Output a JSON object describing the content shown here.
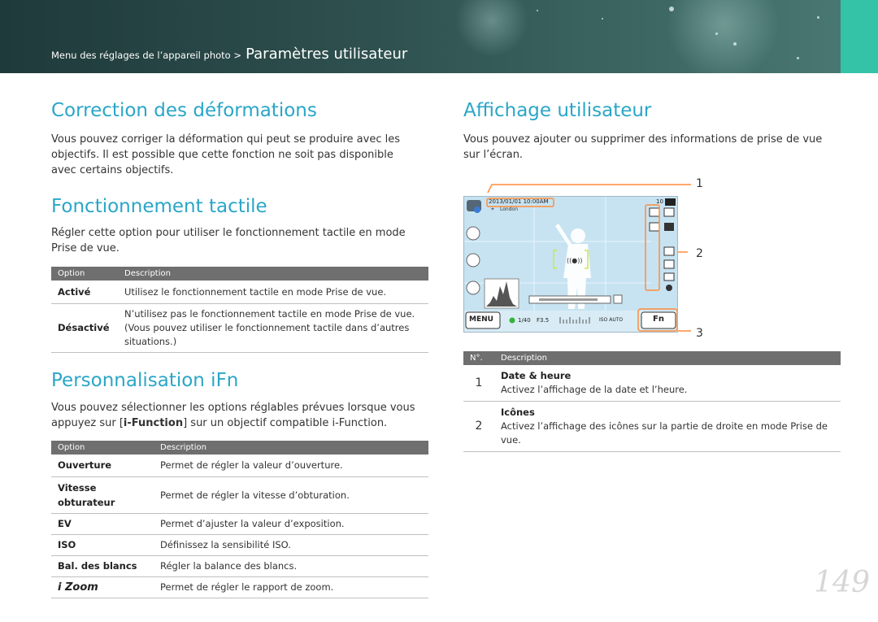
{
  "header": {
    "breadcrumb_small": "Menu des réglages de l’appareil photo >",
    "breadcrumb_big": "Paramètres utilisateur",
    "colors": {
      "accent": "#2aa6c7",
      "teal": "#35c3a8"
    }
  },
  "left": {
    "s1": {
      "title": "Correction des déformations",
      "body": "Vous pouvez corriger la déformation qui peut se produire avec les objectifs. Il est possible que cette fonction ne soit pas disponible avec certains objectifs."
    },
    "s2": {
      "title": "Fonctionnement tactile",
      "body": "Régler cette option pour utiliser le fonctionnement tactile en mode Prise de vue.",
      "head_option": "Option",
      "head_desc": "Description",
      "rows": [
        {
          "k": "Activé",
          "v": "Utilisez le fonctionnement tactile en mode Prise de vue."
        },
        {
          "k": "Désactivé",
          "v": "N’utilisez pas le fonctionnement tactile en mode Prise de vue. (Vous pouvez utiliser le fonctionnement tactile dans d’autres situations.)"
        }
      ]
    },
    "s3": {
      "title": "Personnalisation iFn",
      "body_pre": "Vous pouvez sélectionner les options réglables prévues lorsque vous appuyez sur [",
      "body_bold": "i-Function",
      "body_post": "] sur un objectif compatible i-Function.",
      "head_option": "Option",
      "head_desc": "Description",
      "rows": [
        {
          "k": "Ouverture",
          "v": "Permet de régler la valeur d’ouverture."
        },
        {
          "k": "Vitesse obturateur",
          "v": "Permet de régler la vitesse d’obturation."
        },
        {
          "k": "EV",
          "v": "Permet d’ajuster la valeur d’exposition."
        },
        {
          "k": "ISO",
          "v": "Définissez la sensibilité ISO."
        },
        {
          "k": "Bal. des blancs",
          "v": "Régler la balance des blancs."
        },
        {
          "k": "i Zoom",
          "v": "Permet de régler le rapport de zoom."
        }
      ]
    }
  },
  "right": {
    "title": "Affichage utilisateur",
    "body": "Vous pouvez ajouter ou supprimer des informations de prise de vue sur l’écran.",
    "callouts": [
      "1",
      "2",
      "3"
    ],
    "screen": {
      "datetime": "2013/01/01 10:00AM",
      "location": "London",
      "count": "10",
      "menu": "MENU",
      "shutter": "1/40",
      "aperture": "F3.5",
      "iso": "ISO AUTO",
      "fn": "Fn"
    },
    "table": {
      "head_no": "N°.",
      "head_desc": "Description",
      "rows": [
        {
          "n": "1",
          "title": "Date & heure",
          "desc": "Activez l’affichage de la date et l’heure."
        },
        {
          "n": "2",
          "title": "Icônes",
          "desc": "Activez l’affichage des icônes sur la partie de droite en mode Prise de vue."
        }
      ]
    }
  },
  "page_number": "149"
}
